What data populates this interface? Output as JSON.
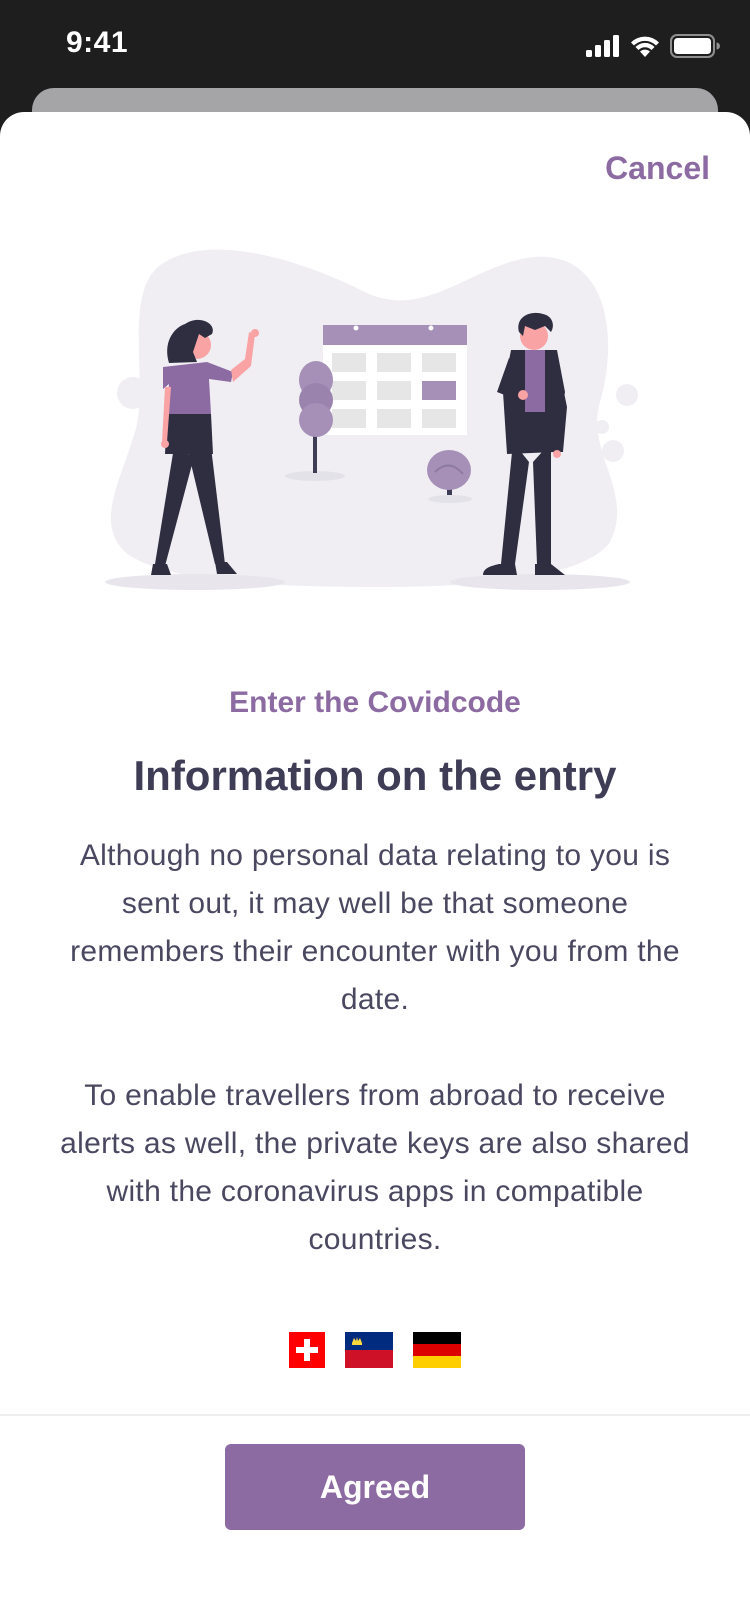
{
  "status_bar": {
    "time": "9:41",
    "icons": [
      "signal-icon",
      "wifi-icon",
      "battery-icon"
    ]
  },
  "modal": {
    "cancel_label": "Cancel",
    "illustration": "people-calendar-illustration",
    "subtitle": "Enter the Covidcode",
    "title": "Information on the entry",
    "paragraph_1": "Although no personal data relating to you is sent out, it may well be that someone remembers their encounter with you from the date.",
    "paragraph_2": "To enable travellers from abroad to receive alerts as well, the private keys are also shared with the coronavirus apps in compatible countries.",
    "flags": [
      "switzerland-flag",
      "liechtenstein-flag",
      "germany-flag"
    ],
    "agreed_label": "Agreed"
  },
  "colors": {
    "accent": "#8c6aa2",
    "title": "#3f3d56",
    "status_bar_bg": "#1e1e1f",
    "swiss_red": "#ff0000",
    "liechtenstein_blue": "#002b7f",
    "liechtenstein_red": "#ce1126",
    "germany_black": "#000000",
    "germany_red": "#dd0000",
    "germany_gold": "#ffce00"
  }
}
